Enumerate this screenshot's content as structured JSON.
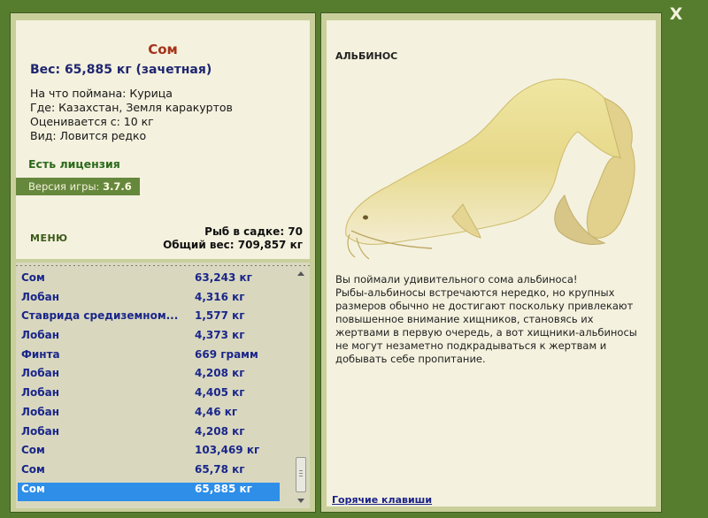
{
  "close_glyph": "X",
  "catch": {
    "name": "Сом",
    "weight": "Вес: 65,885 кг (зачетная)",
    "bait": "На что поймана: Курица",
    "location": "Где: Казахстан, Земля каракуртов",
    "rated_from": "Оценивается с: 10 кг",
    "kind": "Вид: Ловится редко"
  },
  "license": "Есть лицензия",
  "version": {
    "label": "Версия игры: ",
    "value": "3.7.6"
  },
  "menu_label": "МЕНЮ",
  "counts": {
    "fish_in_keepnet": "Рыб в садке: 70",
    "total_weight": "Общий вес: 709,857 кг"
  },
  "list": [
    {
      "name": "Сом",
      "weight": "63,243 кг"
    },
    {
      "name": "Лобан",
      "weight": "4,316 кг"
    },
    {
      "name": "Ставрида средиземном...",
      "weight": "1,577 кг"
    },
    {
      "name": "Лобан",
      "weight": "4,373 кг"
    },
    {
      "name": "Финта",
      "weight": "669 грамм"
    },
    {
      "name": "Лобан",
      "weight": "4,208 кг"
    },
    {
      "name": "Лобан",
      "weight": "4,405 кг"
    },
    {
      "name": "Лобан",
      "weight": "4,46 кг"
    },
    {
      "name": "Лобан",
      "weight": "4,208 кг"
    },
    {
      "name": "Сом",
      "weight": "103,469 кг"
    },
    {
      "name": "Сом",
      "weight": "65,78 кг"
    },
    {
      "name": "Сом",
      "weight": "65,885 кг"
    }
  ],
  "selected_index": 11,
  "detail": {
    "title": "АЛЬБИНОС",
    "description": "Вы поймали удивительного сома альбиноса!\nРыбы-альбиносы встречаются нередко, но крупных размеров обычно не достигают поскольку привлекают повышенное внимание хищников, становясь их жертвами в первую очередь, а вот хищники-альбиносы не могут незаметно подкрадываться к жертвам и добывать себе пропитание."
  },
  "hotkeys_label": "Горячие клавиши",
  "colors": {
    "frame": "#567d2e",
    "panel_bg": "#f4f1de",
    "selected_row": "#2e8ee8",
    "list_text": "#1a268a"
  }
}
